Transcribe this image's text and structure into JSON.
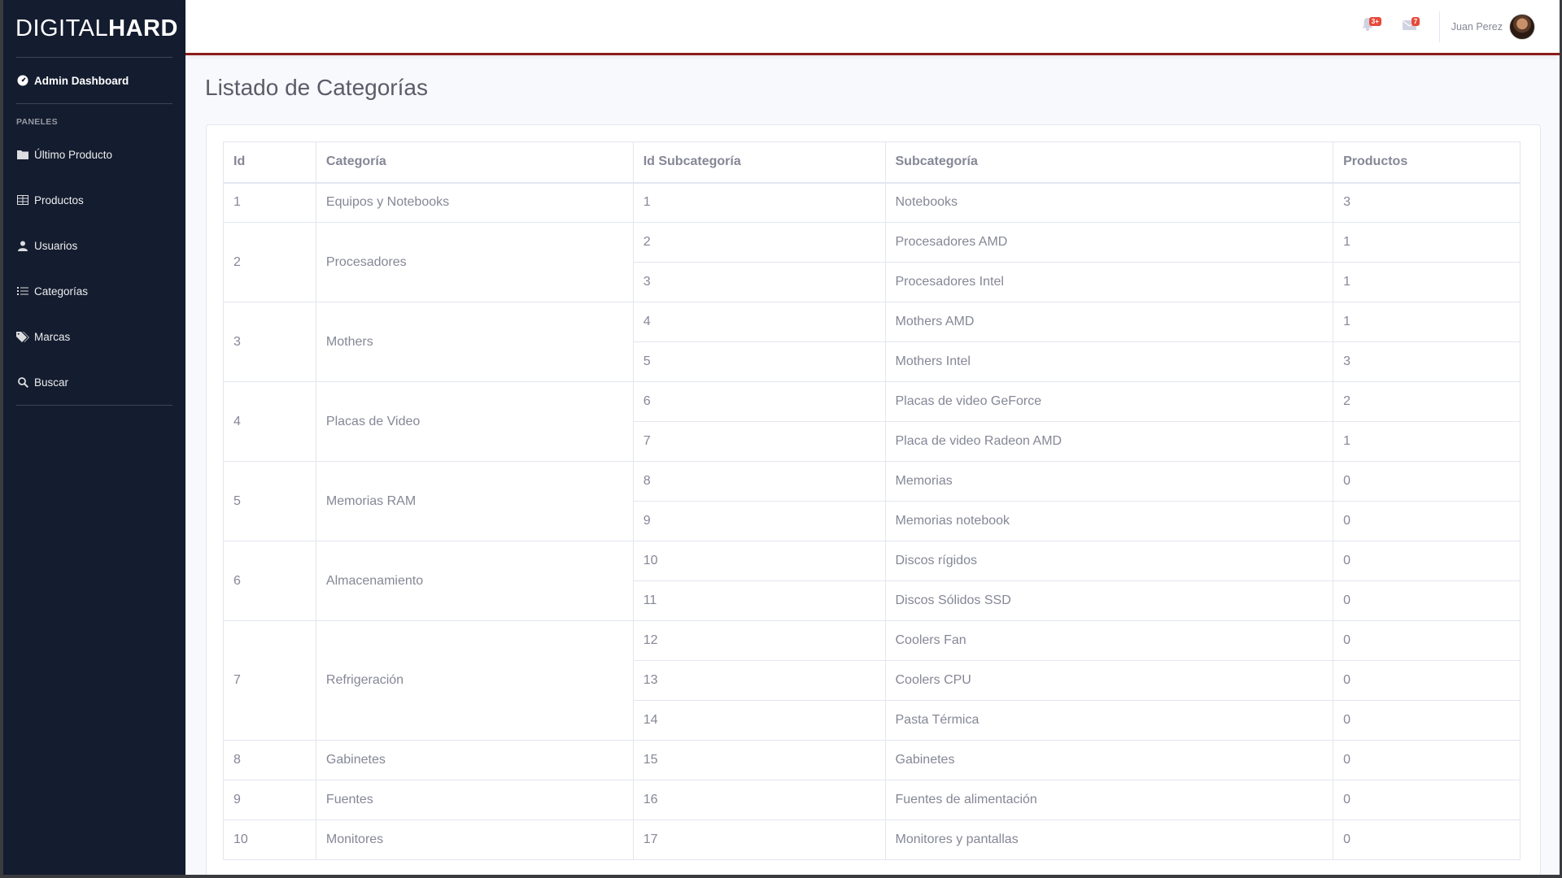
{
  "brand": {
    "thin": "DIGITAL",
    "bold": "HARD"
  },
  "sidebar": {
    "dashboard": {
      "label": "Admin Dashboard",
      "icon": "tachometer-icon"
    },
    "heading": "PANELES",
    "items": [
      {
        "label": "Último Producto",
        "icon": "folder-icon"
      },
      {
        "label": "Productos",
        "icon": "table-icon"
      },
      {
        "label": "Usuarios",
        "icon": "user-icon"
      },
      {
        "label": "Categorías",
        "icon": "list-icon"
      },
      {
        "label": "Marcas",
        "icon": "tags-icon"
      },
      {
        "label": "Buscar",
        "icon": "search-icon"
      }
    ]
  },
  "topbar": {
    "alerts_badge": "3+",
    "messages_badge": "7",
    "user_name": "Juan Perez",
    "accent_color": "#8b1a1a"
  },
  "page": {
    "title": "Listado de Categorías"
  },
  "table": {
    "headers": [
      "Id",
      "Categoría",
      "Id Subcategoría",
      "Subcategoría",
      "Productos"
    ],
    "groups": [
      {
        "id": "1",
        "category": "Equipos y Notebooks",
        "subs": [
          {
            "id": "1",
            "name": "Notebooks",
            "products": "3"
          }
        ]
      },
      {
        "id": "2",
        "category": "Procesadores",
        "subs": [
          {
            "id": "2",
            "name": "Procesadores AMD",
            "products": "1"
          },
          {
            "id": "3",
            "name": "Procesadores Intel",
            "products": "1"
          }
        ]
      },
      {
        "id": "3",
        "category": "Mothers",
        "subs": [
          {
            "id": "4",
            "name": "Mothers AMD",
            "products": "1"
          },
          {
            "id": "5",
            "name": "Mothers Intel",
            "products": "3"
          }
        ]
      },
      {
        "id": "4",
        "category": "Placas de Video",
        "subs": [
          {
            "id": "6",
            "name": "Placas de video GeForce",
            "products": "2"
          },
          {
            "id": "7",
            "name": "Placa de video Radeon AMD",
            "products": "1"
          }
        ]
      },
      {
        "id": "5",
        "category": "Memorias RAM",
        "subs": [
          {
            "id": "8",
            "name": "Memorias",
            "products": "0"
          },
          {
            "id": "9",
            "name": "Memorias notebook",
            "products": "0"
          }
        ]
      },
      {
        "id": "6",
        "category": "Almacenamiento",
        "subs": [
          {
            "id": "10",
            "name": "Discos rígidos",
            "products": "0"
          },
          {
            "id": "11",
            "name": "Discos Sólidos SSD",
            "products": "0"
          }
        ]
      },
      {
        "id": "7",
        "category": "Refrigeración",
        "subs": [
          {
            "id": "12",
            "name": "Coolers Fan",
            "products": "0"
          },
          {
            "id": "13",
            "name": "Coolers CPU",
            "products": "0"
          },
          {
            "id": "14",
            "name": "Pasta Térmica",
            "products": "0"
          }
        ]
      },
      {
        "id": "8",
        "category": "Gabinetes",
        "subs": [
          {
            "id": "15",
            "name": "Gabinetes",
            "products": "0"
          }
        ]
      },
      {
        "id": "9",
        "category": "Fuentes",
        "subs": [
          {
            "id": "16",
            "name": "Fuentes de alimentación",
            "products": "0"
          }
        ]
      },
      {
        "id": "10",
        "category": "Monitores",
        "subs": [
          {
            "id": "17",
            "name": "Monitores y pantallas",
            "products": "0"
          }
        ]
      }
    ]
  }
}
